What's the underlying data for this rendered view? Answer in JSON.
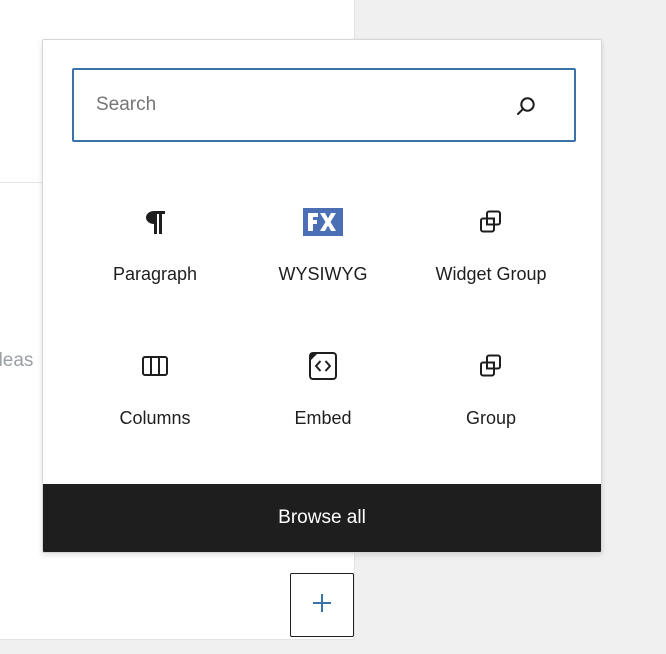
{
  "background": {
    "partial_text": "pleas"
  },
  "inserter": {
    "search": {
      "placeholder": "Search",
      "value": "",
      "icon": "search-icon"
    },
    "blocks": [
      {
        "label": "Paragraph",
        "icon": "paragraph-icon"
      },
      {
        "label": "WYSIWYG",
        "icon": "fx-logo-icon"
      },
      {
        "label": "Widget Group",
        "icon": "group-icon"
      },
      {
        "label": "Columns",
        "icon": "columns-icon"
      },
      {
        "label": "Embed",
        "icon": "embed-icon"
      },
      {
        "label": "Group",
        "icon": "group-icon"
      }
    ],
    "browse_all_label": "Browse all"
  },
  "add_block_button": {
    "icon": "plus-icon",
    "glyph": "+"
  },
  "colors": {
    "accent": "#3a73a9",
    "footer_bg": "#1e1e1e",
    "fx_logo": "#4a6fb5",
    "plus": "#3a73a9"
  }
}
